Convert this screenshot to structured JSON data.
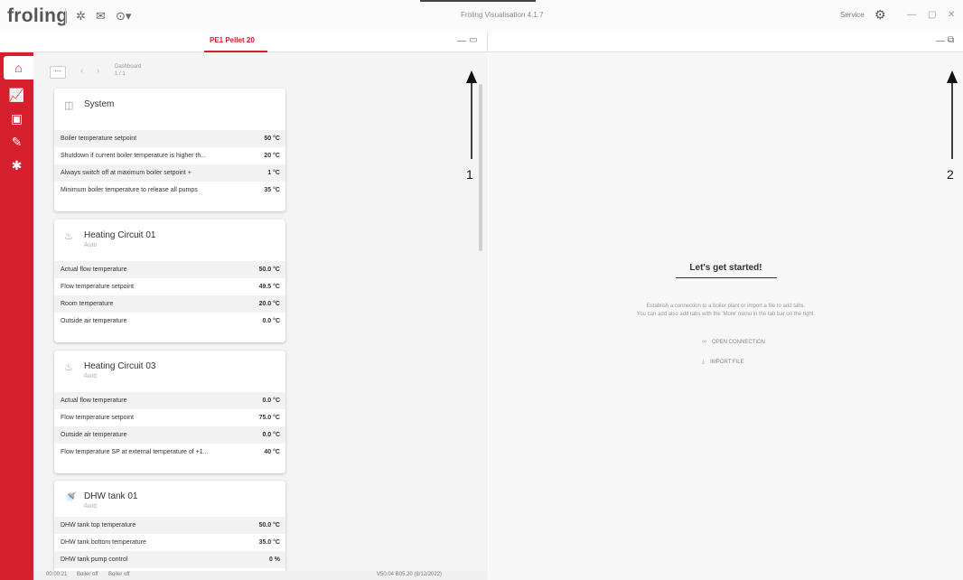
{
  "titlebar": {
    "logo": "froling",
    "app_title": "Froling Visualisation 4.1.7",
    "service_label": "Service",
    "icons": [
      "gear-icon",
      "mail-icon",
      "more-icon"
    ]
  },
  "tabs": {
    "active_tab": "PE1 Pellet 20"
  },
  "breadcrumb": {
    "title": "Dashboard",
    "page": "1 / 1"
  },
  "cards": [
    {
      "title": "System",
      "subtitle": "",
      "icon": "system-icon",
      "rows": [
        {
          "label": "Boiler temperature setpoint",
          "value": "50 °C"
        },
        {
          "label": "Shutdown if current boiler temperature is higher th...",
          "value": "20 °C"
        },
        {
          "label": "Always switch off at maximum boiler setpoint +",
          "value": "1 °C"
        },
        {
          "label": "Minimum boiler temperature to release all pumps",
          "value": "35 °C"
        }
      ]
    },
    {
      "title": "Heating Circuit 01",
      "subtitle": "Auto",
      "icon": "heating-circuit-icon",
      "rows": [
        {
          "label": "Actual flow temperature",
          "value": "50.0 °C"
        },
        {
          "label": "Flow temperature setpoint",
          "value": "49.5 °C"
        },
        {
          "label": "Room temperature",
          "value": "20.0 °C"
        },
        {
          "label": "Outside air temperature",
          "value": "0.0 °C"
        }
      ]
    },
    {
      "title": "Heating Circuit 03",
      "subtitle": "Auto",
      "icon": "heating-circuit-icon",
      "rows": [
        {
          "label": "Actual flow temperature",
          "value": "0.0 °C"
        },
        {
          "label": "Flow temperature setpoint",
          "value": "75.0 °C"
        },
        {
          "label": "Outside air temperature",
          "value": "0.0 °C"
        },
        {
          "label": "Flow temperature SP at external temperature of +1...",
          "value": "40 °C"
        }
      ]
    },
    {
      "title": "DHW tank 01",
      "subtitle": "Auto",
      "icon": "dhw-tank-icon",
      "rows": [
        {
          "label": "DHW tank top temperature",
          "value": "50.0 °C"
        },
        {
          "label": "DHW tank bottom temperature",
          "value": "35.0 °C"
        },
        {
          "label": "DHW tank pump control",
          "value": "0 %"
        }
      ]
    }
  ],
  "statusbar": {
    "code": "00:00:21",
    "status1": "Boiler off",
    "status2": "Boiler off",
    "version": "V50.04 B05.20 (8/12/2022)"
  },
  "right_panel": {
    "heading": "Let's get started!",
    "line1": "Establish a connection to a boiler plant or import a file to add tabs.",
    "line2": "You can add also add tabs with the 'More' menu in the tab bar on the right.",
    "open_connection": "OPEN CONNECTION",
    "import_file": "IMPORT FILE"
  },
  "callouts": {
    "one": "1",
    "two": "2"
  }
}
